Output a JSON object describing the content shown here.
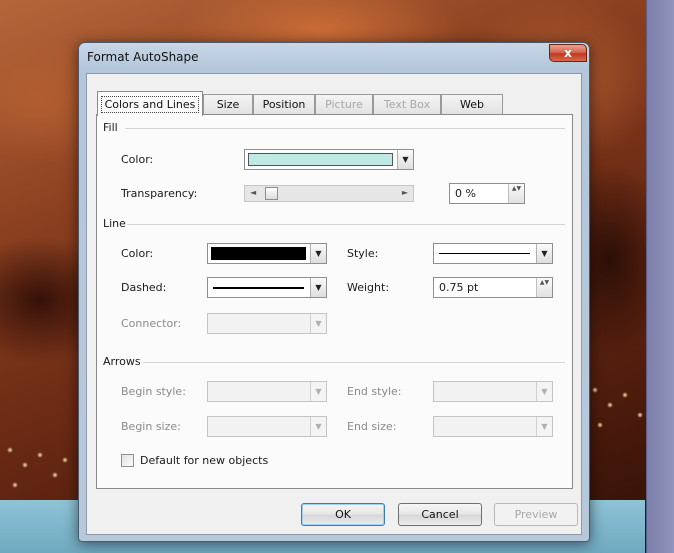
{
  "dialog": {
    "title": "Format AutoShape",
    "close_glyph": "x"
  },
  "tabs": [
    {
      "label": "Colors and Lines",
      "active": true,
      "enabled": true
    },
    {
      "label": "Size",
      "active": false,
      "enabled": true
    },
    {
      "label": "Position",
      "active": false,
      "enabled": true
    },
    {
      "label": "Picture",
      "active": false,
      "enabled": false
    },
    {
      "label": "Text Box",
      "active": false,
      "enabled": false
    },
    {
      "label": "Web",
      "active": false,
      "enabled": true
    }
  ],
  "fill": {
    "section_label": "Fill",
    "color_label": "Color:",
    "color_value": "#bfe9e3",
    "transparency_label": "Transparency:",
    "transparency_value": "0 %",
    "transparency_fraction": 0.0
  },
  "line": {
    "section_label": "Line",
    "color_label": "Color:",
    "color_value": "#000000",
    "style_label": "Style:",
    "dashed_label": "Dashed:",
    "weight_label": "Weight:",
    "weight_value": "0.75 pt",
    "connector_label": "Connector:"
  },
  "arrows": {
    "section_label": "Arrows",
    "begin_style_label": "Begin style:",
    "end_style_label": "End style:",
    "begin_size_label": "Begin size:",
    "end_size_label": "End size:"
  },
  "default_checkbox": {
    "label": "Default for new objects",
    "checked": false
  },
  "buttons": {
    "ok": "OK",
    "cancel": "Cancel",
    "preview": "Preview"
  },
  "icons": {
    "dropdown": "▼",
    "spin": "▲▼",
    "slider_left": "◄",
    "slider_right": "►"
  }
}
